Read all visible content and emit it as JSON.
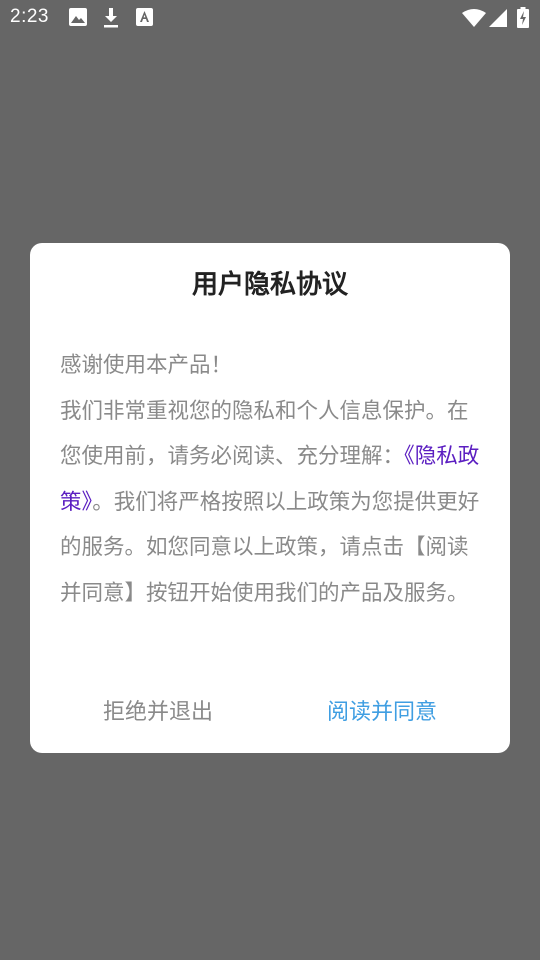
{
  "status_bar": {
    "time": "2:23",
    "icons": [
      "image-icon",
      "download-icon",
      "a-icon",
      "wifi-icon",
      "signal-icon",
      "battery-icon"
    ]
  },
  "dialog": {
    "title": "用户隐私协议",
    "body": {
      "line1": "感谢使用本产品！",
      "line2": "我们非常重视您的隐私和个人信息保护。在您使用前，请务必阅读、充分理解：",
      "link": "《隐私政策》",
      "line3": "。我们将严格按照以上政策为您提供更好的服务。如您同意以上政策，请点击【阅读并同意】按钮开始使用我们的产品及服务。"
    },
    "reject_label": "拒绝并退出",
    "agree_label": "阅读并同意"
  },
  "colors": {
    "overlay": "#666666",
    "link": "#5b1ec1",
    "agree": "#3f9ee2",
    "body_text": "#8a8a8a"
  }
}
